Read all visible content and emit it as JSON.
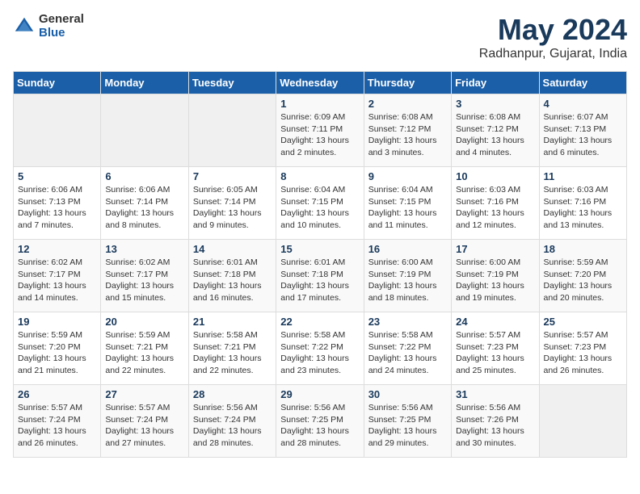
{
  "header": {
    "logo_general": "General",
    "logo_blue": "Blue",
    "title": "May 2024",
    "subtitle": "Radhanpur, Gujarat, India"
  },
  "calendar": {
    "days_of_week": [
      "Sunday",
      "Monday",
      "Tuesday",
      "Wednesday",
      "Thursday",
      "Friday",
      "Saturday"
    ],
    "weeks": [
      [
        {
          "day": "",
          "info": ""
        },
        {
          "day": "",
          "info": ""
        },
        {
          "day": "",
          "info": ""
        },
        {
          "day": "1",
          "info": "Sunrise: 6:09 AM\nSunset: 7:11 PM\nDaylight: 13 hours and 2 minutes."
        },
        {
          "day": "2",
          "info": "Sunrise: 6:08 AM\nSunset: 7:12 PM\nDaylight: 13 hours and 3 minutes."
        },
        {
          "day": "3",
          "info": "Sunrise: 6:08 AM\nSunset: 7:12 PM\nDaylight: 13 hours and 4 minutes."
        },
        {
          "day": "4",
          "info": "Sunrise: 6:07 AM\nSunset: 7:13 PM\nDaylight: 13 hours and 6 minutes."
        }
      ],
      [
        {
          "day": "5",
          "info": "Sunrise: 6:06 AM\nSunset: 7:13 PM\nDaylight: 13 hours and 7 minutes."
        },
        {
          "day": "6",
          "info": "Sunrise: 6:06 AM\nSunset: 7:14 PM\nDaylight: 13 hours and 8 minutes."
        },
        {
          "day": "7",
          "info": "Sunrise: 6:05 AM\nSunset: 7:14 PM\nDaylight: 13 hours and 9 minutes."
        },
        {
          "day": "8",
          "info": "Sunrise: 6:04 AM\nSunset: 7:15 PM\nDaylight: 13 hours and 10 minutes."
        },
        {
          "day": "9",
          "info": "Sunrise: 6:04 AM\nSunset: 7:15 PM\nDaylight: 13 hours and 11 minutes."
        },
        {
          "day": "10",
          "info": "Sunrise: 6:03 AM\nSunset: 7:16 PM\nDaylight: 13 hours and 12 minutes."
        },
        {
          "day": "11",
          "info": "Sunrise: 6:03 AM\nSunset: 7:16 PM\nDaylight: 13 hours and 13 minutes."
        }
      ],
      [
        {
          "day": "12",
          "info": "Sunrise: 6:02 AM\nSunset: 7:17 PM\nDaylight: 13 hours and 14 minutes."
        },
        {
          "day": "13",
          "info": "Sunrise: 6:02 AM\nSunset: 7:17 PM\nDaylight: 13 hours and 15 minutes."
        },
        {
          "day": "14",
          "info": "Sunrise: 6:01 AM\nSunset: 7:18 PM\nDaylight: 13 hours and 16 minutes."
        },
        {
          "day": "15",
          "info": "Sunrise: 6:01 AM\nSunset: 7:18 PM\nDaylight: 13 hours and 17 minutes."
        },
        {
          "day": "16",
          "info": "Sunrise: 6:00 AM\nSunset: 7:19 PM\nDaylight: 13 hours and 18 minutes."
        },
        {
          "day": "17",
          "info": "Sunrise: 6:00 AM\nSunset: 7:19 PM\nDaylight: 13 hours and 19 minutes."
        },
        {
          "day": "18",
          "info": "Sunrise: 5:59 AM\nSunset: 7:20 PM\nDaylight: 13 hours and 20 minutes."
        }
      ],
      [
        {
          "day": "19",
          "info": "Sunrise: 5:59 AM\nSunset: 7:20 PM\nDaylight: 13 hours and 21 minutes."
        },
        {
          "day": "20",
          "info": "Sunrise: 5:59 AM\nSunset: 7:21 PM\nDaylight: 13 hours and 22 minutes."
        },
        {
          "day": "21",
          "info": "Sunrise: 5:58 AM\nSunset: 7:21 PM\nDaylight: 13 hours and 22 minutes."
        },
        {
          "day": "22",
          "info": "Sunrise: 5:58 AM\nSunset: 7:22 PM\nDaylight: 13 hours and 23 minutes."
        },
        {
          "day": "23",
          "info": "Sunrise: 5:58 AM\nSunset: 7:22 PM\nDaylight: 13 hours and 24 minutes."
        },
        {
          "day": "24",
          "info": "Sunrise: 5:57 AM\nSunset: 7:23 PM\nDaylight: 13 hours and 25 minutes."
        },
        {
          "day": "25",
          "info": "Sunrise: 5:57 AM\nSunset: 7:23 PM\nDaylight: 13 hours and 26 minutes."
        }
      ],
      [
        {
          "day": "26",
          "info": "Sunrise: 5:57 AM\nSunset: 7:24 PM\nDaylight: 13 hours and 26 minutes."
        },
        {
          "day": "27",
          "info": "Sunrise: 5:57 AM\nSunset: 7:24 PM\nDaylight: 13 hours and 27 minutes."
        },
        {
          "day": "28",
          "info": "Sunrise: 5:56 AM\nSunset: 7:24 PM\nDaylight: 13 hours and 28 minutes."
        },
        {
          "day": "29",
          "info": "Sunrise: 5:56 AM\nSunset: 7:25 PM\nDaylight: 13 hours and 28 minutes."
        },
        {
          "day": "30",
          "info": "Sunrise: 5:56 AM\nSunset: 7:25 PM\nDaylight: 13 hours and 29 minutes."
        },
        {
          "day": "31",
          "info": "Sunrise: 5:56 AM\nSunset: 7:26 PM\nDaylight: 13 hours and 30 minutes."
        },
        {
          "day": "",
          "info": ""
        }
      ]
    ]
  }
}
